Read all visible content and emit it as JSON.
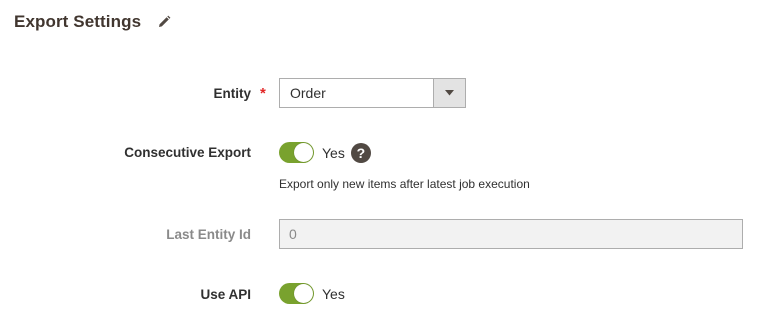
{
  "section": {
    "title": "Export Settings",
    "edit_icon": "pencil-icon"
  },
  "fields": {
    "entity": {
      "label": "Entity",
      "required_mark": "*",
      "value": "Order"
    },
    "consecutive_export": {
      "label": "Consecutive Export",
      "state": "Yes",
      "enabled": true,
      "help_glyph": "?",
      "note": "Export only new items after latest job execution"
    },
    "last_entity_id": {
      "label": "Last Entity Id",
      "value": "0",
      "disabled": true
    },
    "use_api": {
      "label": "Use API",
      "state": "Yes",
      "enabled": true
    }
  },
  "colors": {
    "toggle_on": "#79a22e",
    "required": "#e22626",
    "title": "#41362f"
  }
}
